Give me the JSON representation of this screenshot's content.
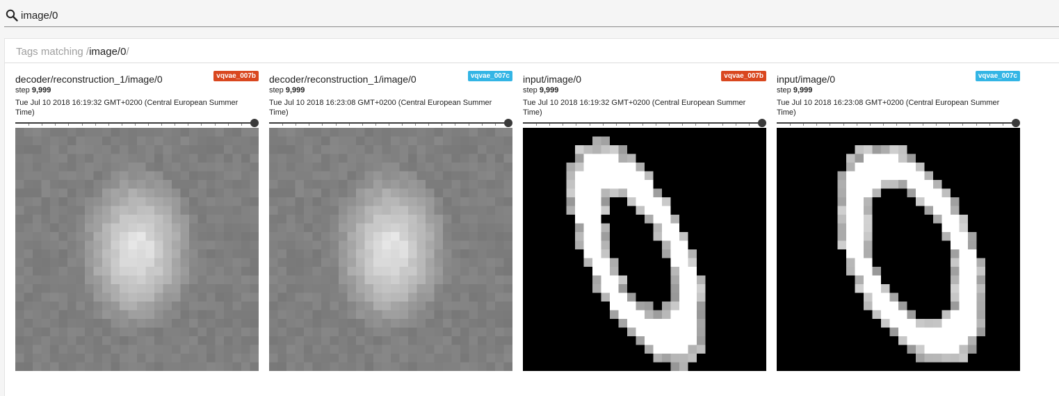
{
  "search": {
    "query": "image/0"
  },
  "header": {
    "label": "Tags matching ",
    "open_slash": "/",
    "query": "image/0",
    "close_slash": "/"
  },
  "colors": {
    "vqvae_007b": "#d9471f",
    "vqvae_007c": "#33b5e5"
  },
  "cards": [
    {
      "tag": "decoder/reconstruction_1/image/0",
      "run": "vqvae_007b",
      "step_prefix": "step ",
      "step": "9,999",
      "timestamp": "Tue Jul 10 2018 16:19:32 GMT+0200 (Central European Summer Time)",
      "image_kind": "reconstruction-blurry-zero"
    },
    {
      "tag": "decoder/reconstruction_1/image/0",
      "run": "vqvae_007c",
      "step_prefix": "step ",
      "step": "9,999",
      "timestamp": "Tue Jul 10 2018 16:23:08 GMT+0200 (Central European Summer Time)",
      "image_kind": "reconstruction-blurry-zero"
    },
    {
      "tag": "input/image/0",
      "run": "vqvae_007b",
      "step_prefix": "step ",
      "step": "9,999",
      "timestamp": "Tue Jul 10 2018 16:19:32 GMT+0200 (Central European Summer Time)",
      "image_kind": "mnist-digit-zero-thin"
    },
    {
      "tag": "input/image/0",
      "run": "vqvae_007c",
      "step_prefix": "step ",
      "step": "9,999",
      "timestamp": "Tue Jul 10 2018 16:23:08 GMT+0200 (Central European Summer Time)",
      "image_kind": "mnist-digit-zero-wide"
    }
  ]
}
